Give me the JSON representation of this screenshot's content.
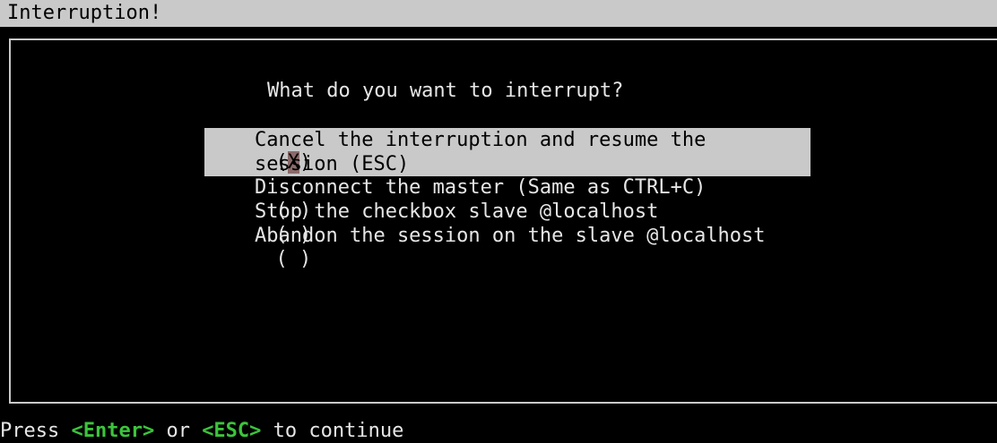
{
  "window": {
    "title": "Interruption!"
  },
  "dialog": {
    "question": "What do you want to interrupt?",
    "options": [
      {
        "radio_open": "(",
        "mark": "X",
        "radio_close": ")",
        "label": "Cancel the interruption and resume the session (ESC)",
        "selected": true
      },
      {
        "radio_open": "(",
        "mark": " ",
        "radio_close": ")",
        "label": "Disconnect the master (Same as CTRL+C)",
        "selected": false
      },
      {
        "radio_open": "(",
        "mark": " ",
        "radio_close": ")",
        "label": "Stop the checkbox slave @localhost",
        "selected": false
      },
      {
        "radio_open": "(",
        "mark": " ",
        "radio_close": ")",
        "label": "Abandon the session on the slave @localhost",
        "selected": false
      }
    ]
  },
  "footer": {
    "prefix": "Press ",
    "key1": "<Enter>",
    "middle": " or ",
    "key2": "<ESC>",
    "suffix": " to continue"
  },
  "colors": {
    "bar": "#c9c9c9",
    "key_highlight": "#3cc43c",
    "cursor": "#8a6a6a",
    "background": "#000000"
  }
}
